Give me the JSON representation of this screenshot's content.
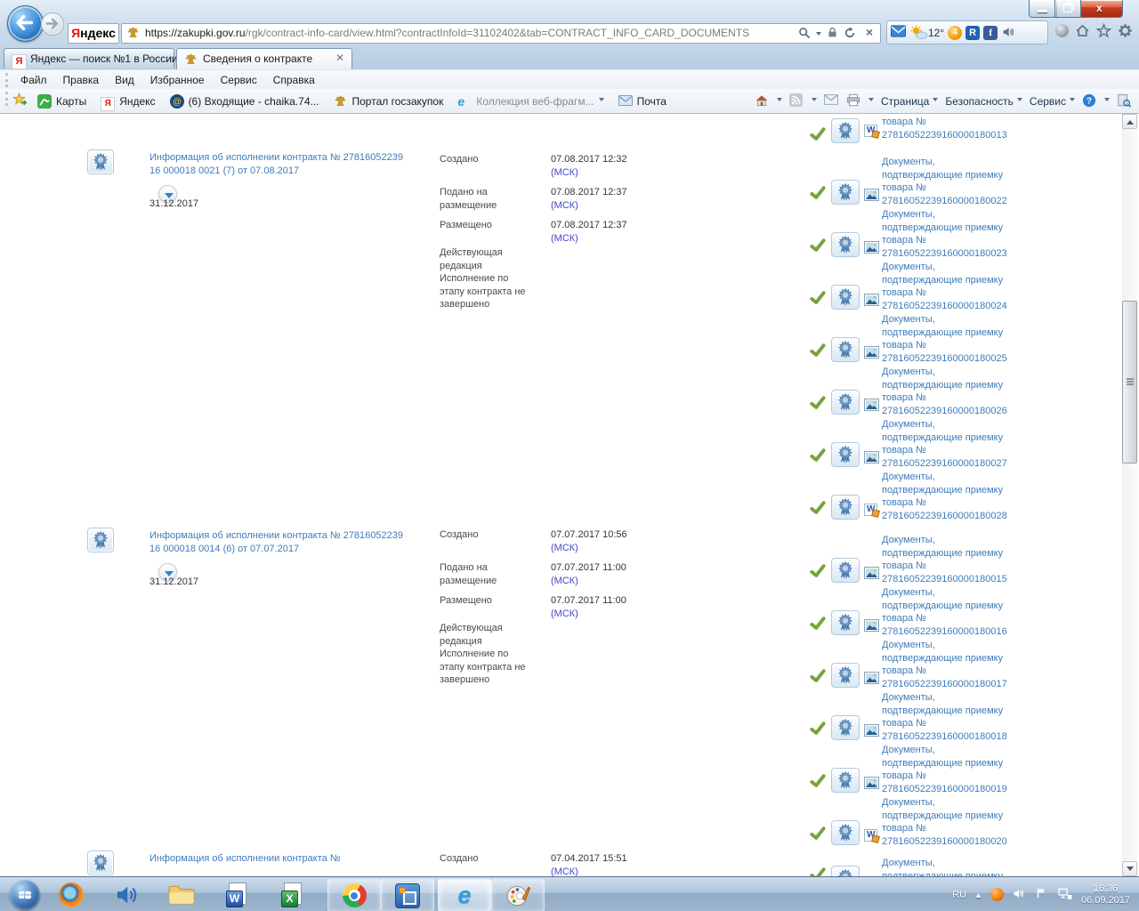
{
  "browser": {
    "logo": {
      "first": "Я",
      "rest": "ндекс"
    },
    "url": {
      "domain": "https://zakupki.gov.ru",
      "path": "/rgk/contract-info-card/view.html?contractInfoId=31102402&tab=CONTRACT_INFO_CARD_DOCUMENTS"
    },
    "weather_temp": "12°",
    "notification_count": "4",
    "tabs": [
      {
        "title": "Яндекс — поиск №1 в России",
        "icon": "yandex-icon",
        "active": false
      },
      {
        "title": "Сведения о контракте",
        "icon": "coat-of-arms-icon",
        "active": true,
        "closable": true
      }
    ],
    "menu": [
      "Файл",
      "Правка",
      "Вид",
      "Избранное",
      "Сервис",
      "Справка"
    ],
    "favorites": [
      {
        "label": "Карты",
        "icon": "maps-icon"
      },
      {
        "label": "Яндекс",
        "icon": "yandex-icon"
      },
      {
        "label": "(6) Входящие - chaika.74...",
        "icon": "mail-at-icon"
      },
      {
        "label": "Портал госзакупок",
        "icon": "coat-of-arms-icon"
      },
      {
        "label": "Коллекция веб-фрагм...",
        "icon": "ie-icon",
        "muted": true,
        "dropdown": true
      },
      {
        "label": "Почта",
        "icon": "envelope-icon"
      }
    ],
    "command_bar": {
      "page": "Страница",
      "security": "Безопасность",
      "tools": "Сервис"
    }
  },
  "content": {
    "groups": [
      {
        "title": "Информация об исполнении контракта № 27816052239 16 000018 0021 (7) от 07.08.2017",
        "date": "31.12.2017",
        "fields": [
          {
            "label": "Создано",
            "value": "07.08.2017 12:32",
            "tz": "(МСК)"
          },
          {
            "label": "Подано на размещение",
            "value": "07.08.2017 12:37",
            "tz": "(МСК)"
          },
          {
            "label": "Размещено",
            "value": "07.08.2017 12:37",
            "tz": "(МСК)"
          }
        ],
        "status": "Действующая редакция Исполнение по этапу контракта не завершено",
        "partial_doc": {
          "visible_text": "товара №",
          "number": "27816052239160000180013",
          "type": "word"
        },
        "documents": [
          {
            "label": "Документы, подтверждающие приемку товара №",
            "number": "27816052239160000180022",
            "type": "image"
          },
          {
            "label": "Документы, подтверждающие приемку товара №",
            "number": "27816052239160000180023",
            "type": "image"
          },
          {
            "label": "Документы, подтверждающие приемку товара №",
            "number": "27816052239160000180024",
            "type": "image"
          },
          {
            "label": "Документы, подтверждающие приемку товара №",
            "number": "27816052239160000180025",
            "type": "image"
          },
          {
            "label": "Документы, подтверждающие приемку товара №",
            "number": "27816052239160000180026",
            "type": "image"
          },
          {
            "label": "Документы, подтверждающие приемку товара №",
            "number": "27816052239160000180027",
            "type": "image"
          },
          {
            "label": "Документы, подтверждающие приемку товара №",
            "number": "27816052239160000180028",
            "type": "word"
          }
        ]
      },
      {
        "title": "Информация об исполнении контракта № 27816052239 16 000018 0014 (6) от 07.07.2017",
        "date": "31.12.2017",
        "fields": [
          {
            "label": "Создано",
            "value": "07.07.2017 10:56",
            "tz": "(МСК)"
          },
          {
            "label": "Подано на размещение",
            "value": "07.07.2017 11:00",
            "tz": "(МСК)"
          },
          {
            "label": "Размещено",
            "value": "07.07.2017 11:00",
            "tz": "(МСК)"
          }
        ],
        "status": "Действующая редакция Исполнение по этапу контракта не завершено",
        "documents": [
          {
            "label": "Документы, подтверждающие приемку товара №",
            "number": "27816052239160000180015",
            "type": "image"
          },
          {
            "label": "Документы, подтверждающие приемку товара №",
            "number": "27816052239160000180016",
            "type": "image"
          },
          {
            "label": "Документы, подтверждающие приемку товара №",
            "number": "27816052239160000180017",
            "type": "image"
          },
          {
            "label": "Документы, подтверждающие приемку товара №",
            "number": "27816052239160000180018",
            "type": "image"
          },
          {
            "label": "Документы, подтверждающие приемку товара №",
            "number": "27816052239160000180019",
            "type": "image"
          },
          {
            "label": "Документы, подтверждающие приемку товара №",
            "number": "27816052239160000180020",
            "type": "word"
          }
        ]
      },
      {
        "title": "Информация об исполнении контракта №",
        "fields": [
          {
            "label": "Создано",
            "value": "07.04.2017 15:51",
            "tz": "(МСК)"
          }
        ],
        "partial_bottom_doc": {
          "visible_text": "Документы, подтверждающие приемку"
        }
      }
    ]
  },
  "taskbar": {
    "apps": [
      "start",
      "firefox",
      "volume",
      "explorer",
      "word",
      "excel",
      "chrome",
      "vmware",
      "ie",
      "paint"
    ],
    "tray": {
      "lang": "RU",
      "time": "16:36",
      "date": "06.09.2017"
    }
  },
  "colors": {
    "link": "#3e7cba",
    "timezone_link": "#4646c8",
    "check_green": "#77a33d",
    "accent_blue": "#2f81c8"
  }
}
